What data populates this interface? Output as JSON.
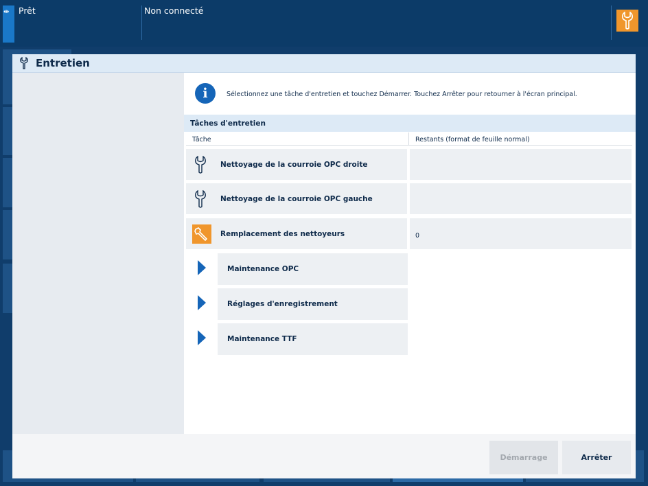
{
  "status": {
    "ready": "Prêt",
    "connection": "Non connecté"
  },
  "dialog": {
    "title": "Entretien",
    "info_text": "Sélectionnez une tâche d'entretien et touchez Démarrer. Touchez Arrêter pour retourner à l'écran principal.",
    "section_title": "Tâches d'entretien",
    "columns": {
      "task": "Tâche",
      "remaining": "Restants (format de feuille normal)"
    },
    "tasks": [
      {
        "label": "Nettoyage de la courroie OPC droite",
        "remaining": "",
        "icon": "wrench-icon",
        "highlighted": false
      },
      {
        "label": "Nettoyage de la courroie OPC gauche",
        "remaining": "",
        "icon": "wrench-icon",
        "highlighted": false
      },
      {
        "label": "Remplacement des nettoyeurs",
        "remaining": "0",
        "icon": "wrench-icon",
        "highlighted": true
      }
    ],
    "submenus": [
      {
        "label": "Maintenance OPC"
      },
      {
        "label": "Réglages d'enregistrement"
      },
      {
        "label": "Maintenance TTF"
      }
    ],
    "buttons": {
      "start": "Démarrage",
      "stop": "Arrêter"
    }
  },
  "colors": {
    "accent_orange": "#f0962c",
    "primary_blue": "#1565b8",
    "header_navy": "#0c3b68"
  }
}
